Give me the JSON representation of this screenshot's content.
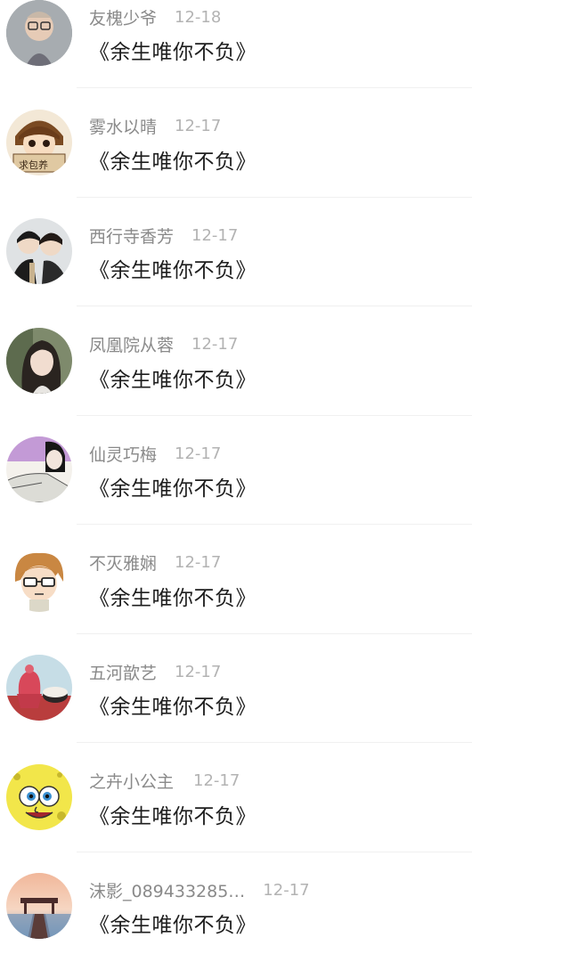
{
  "comments": [
    {
      "name": "友槐少爷",
      "date": "12-18",
      "text": "《余生唯你不负》",
      "avatar": "boy-photo"
    },
    {
      "name": "雾水以晴",
      "date": "12-17",
      "text": "《余生唯你不负》",
      "avatar": "cartoon-sign"
    },
    {
      "name": "西行寺香芳",
      "date": "12-17",
      "text": "《余生唯你不负》",
      "avatar": "couple-photo"
    },
    {
      "name": "凤凰院从蓉",
      "date": "12-17",
      "text": "《余生唯你不负》",
      "avatar": "girl-photo"
    },
    {
      "name": "仙灵巧梅",
      "date": "12-17",
      "text": "《余生唯你不负》",
      "avatar": "comic-figure"
    },
    {
      "name": "不灭雅娴",
      "date": "12-17",
      "text": "《余生唯你不负》",
      "avatar": "anime-glasses"
    },
    {
      "name": "五河歆艺",
      "date": "12-17",
      "text": "《余生唯你不负》",
      "avatar": "dessert-photo"
    },
    {
      "name": "之卉小公主",
      "date": "12-17",
      "text": "《余生唯你不负》",
      "avatar": "sponge-cartoon"
    },
    {
      "name": "沫影_089433285…",
      "date": "12-17",
      "text": "《余生唯你不负》",
      "avatar": "pier-sunset"
    }
  ],
  "colors": {
    "name": "#8a8a8a",
    "date": "#b3b3b3",
    "text": "#1e1e1e",
    "divider": "#f0f0f0"
  }
}
